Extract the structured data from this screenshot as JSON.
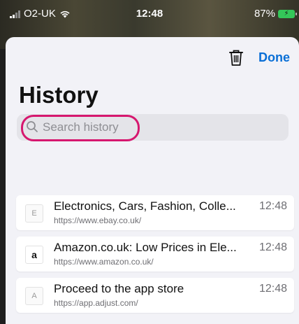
{
  "status_bar": {
    "carrier": "O2-UK",
    "time": "12:48",
    "battery": "87%"
  },
  "header": {
    "done_label": "Done",
    "title": "History"
  },
  "search": {
    "placeholder": "Search history",
    "highlight_color": "#d6176f"
  },
  "history": {
    "items": [
      {
        "icon_letter": "E",
        "title": "Electronics, Cars, Fashion, Colle...",
        "url": "https://www.ebay.co.uk/",
        "time": "12:48"
      },
      {
        "icon_letter": "a",
        "title": "Amazon.co.uk: Low Prices in Ele...",
        "url": "https://www.amazon.co.uk/",
        "time": "12:48"
      },
      {
        "icon_letter": "A",
        "title": "Proceed to the app store",
        "url": "https://app.adjust.com/",
        "time": "12:48"
      }
    ]
  },
  "colors": {
    "accent": "#0a6fd6",
    "battery_charging": "#34c759"
  }
}
